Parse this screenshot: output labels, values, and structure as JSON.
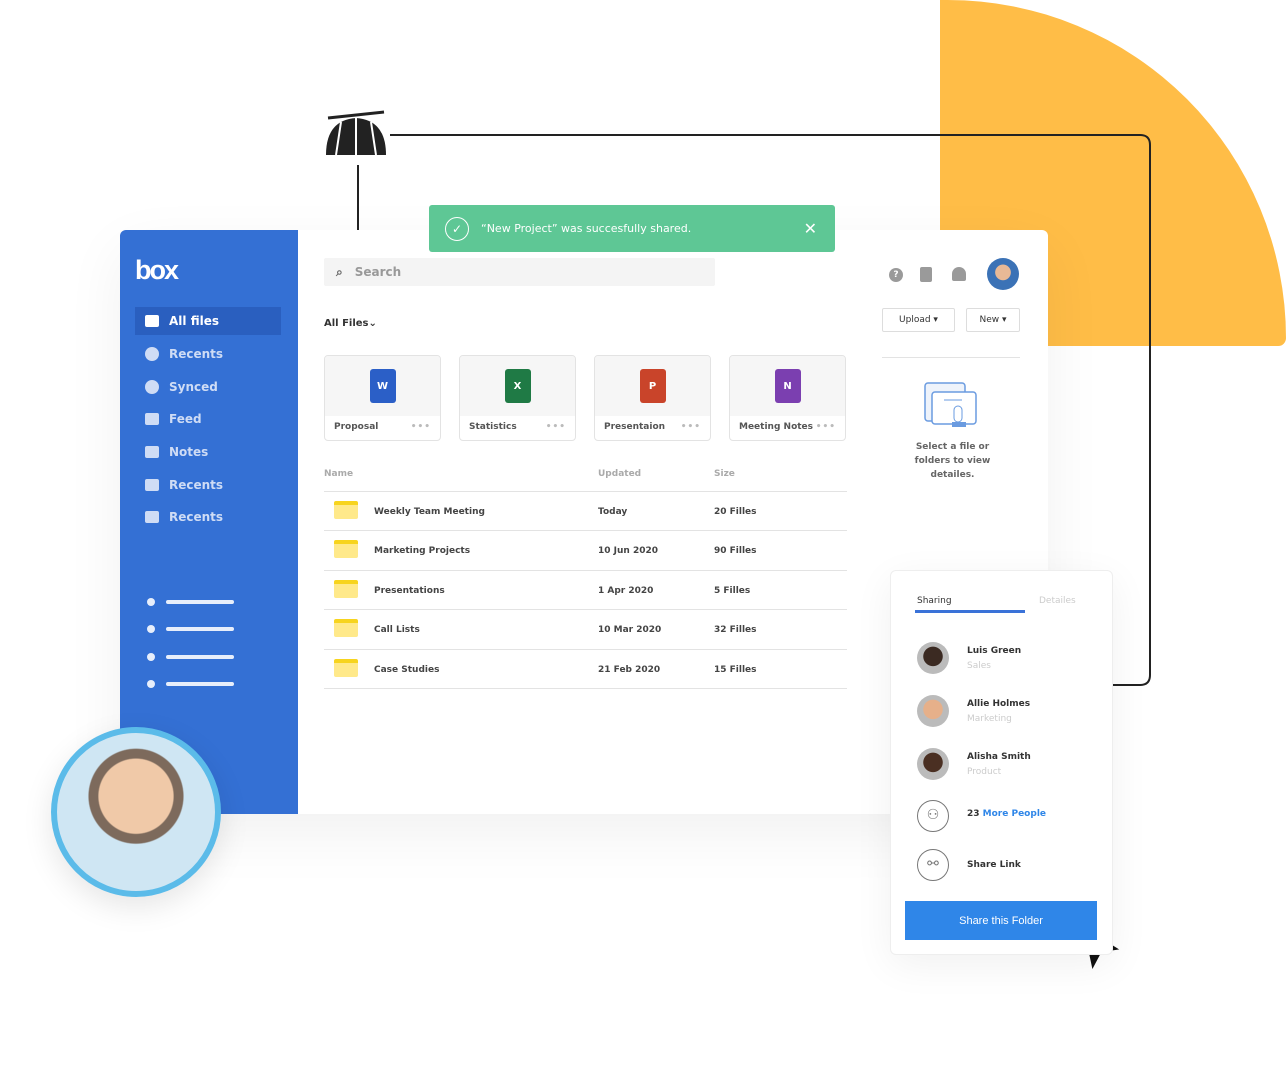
{
  "colors": {
    "accent": "#3470d4",
    "toast": "#5ec795",
    "decor": "#ffbd47",
    "primary_button": "#2f86e8"
  },
  "toast": {
    "message": "“New Project” was succesfully shared.",
    "icon": "check-circle-icon",
    "close_icon": "close-icon"
  },
  "sidebar": {
    "logo": "box",
    "items": [
      {
        "label": "All files",
        "icon": "folder-icon",
        "active": true
      },
      {
        "label": "Recents",
        "icon": "clock-icon"
      },
      {
        "label": "Synced",
        "icon": "check-circle-icon"
      },
      {
        "label": "Feed",
        "icon": "feed-icon"
      },
      {
        "label": "Notes",
        "icon": "notes-icon"
      },
      {
        "label": "Recents",
        "icon": "flag-icon"
      },
      {
        "label": "Recents",
        "icon": "trash-icon"
      }
    ]
  },
  "search": {
    "placeholder": "Search"
  },
  "breadcrumb": "All Files",
  "cards": [
    {
      "label": "Proposal",
      "icon": "W",
      "color": "#2b5fc7"
    },
    {
      "label": "Statistics",
      "icon": "X",
      "color": "#1f7a45"
    },
    {
      "label": "Presentaion",
      "icon": "P",
      "color": "#c9442a"
    },
    {
      "label": "Meeting Notes",
      "icon": "N",
      "color": "#7b3fb0"
    }
  ],
  "table": {
    "headers": [
      "Name",
      "Updated",
      "Size"
    ],
    "rows": [
      {
        "name": "Weekly Team Meeting",
        "updated": "Today",
        "size": "20 Filles"
      },
      {
        "name": "Marketing Projects",
        "updated": "10 Jun 2020",
        "size": "90 Filles"
      },
      {
        "name": "Presentations",
        "updated": "1 Apr 2020",
        "size": "5 Filles"
      },
      {
        "name": "Call Lists",
        "updated": "10 Mar 2020",
        "size": "32 Filles"
      },
      {
        "name": "Case Studies",
        "updated": "21 Feb 2020",
        "size": "15 Filles"
      }
    ]
  },
  "toolbar": {
    "upload": "Upload ▾",
    "new": "New ▾"
  },
  "details": {
    "empty_text": "Select a file or folders to view detailes."
  },
  "sharing": {
    "tabs": [
      "Sharing",
      "Detailes"
    ],
    "people": [
      {
        "name": "Luis Green",
        "role": "Sales"
      },
      {
        "name": "Allie Holmes",
        "role": "Marketing"
      },
      {
        "name": "Alisha Smith",
        "role": "Product"
      }
    ],
    "more_count": "23",
    "more_label": "More People",
    "share_link": "Share Link",
    "button": "Share this Folder"
  }
}
